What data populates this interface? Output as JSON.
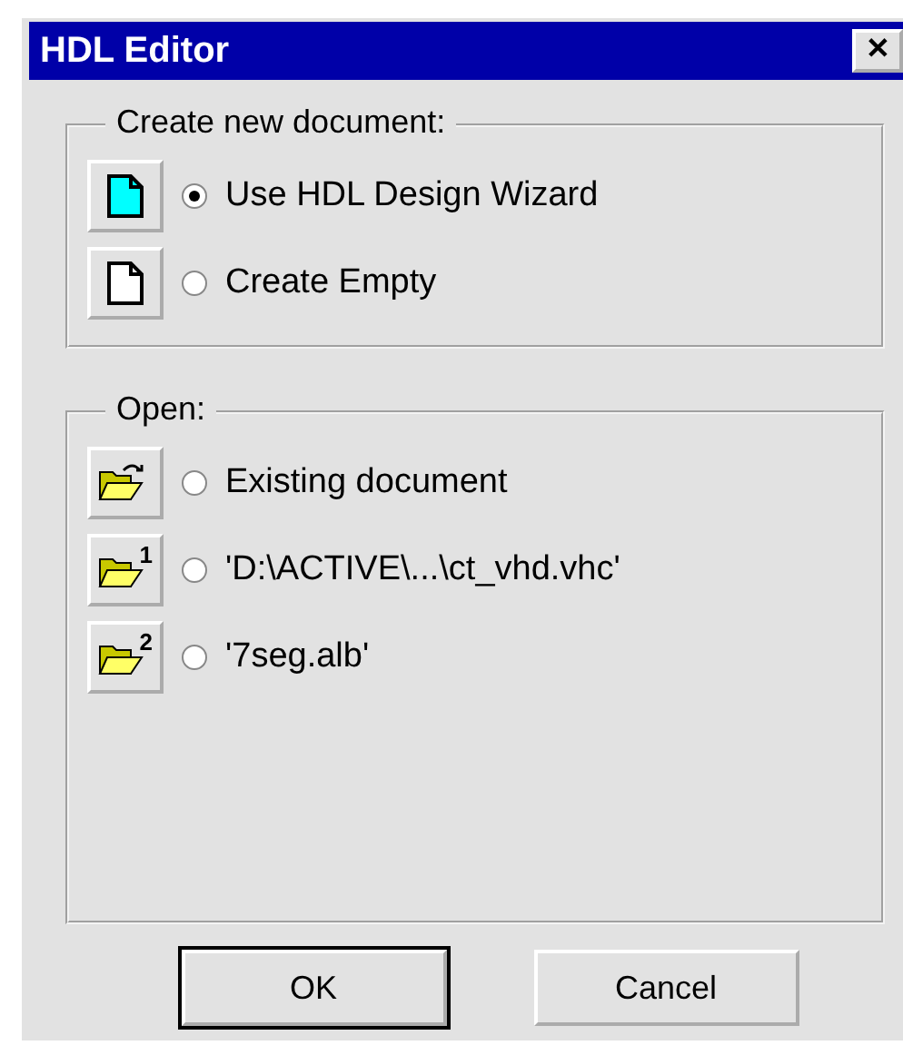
{
  "window": {
    "title": "HDL Editor",
    "close": "✕"
  },
  "groups": [
    {
      "title": "Create new document:",
      "options": [
        {
          "kind": "wizard",
          "label": "Use HDL Design Wizard",
          "selected": true
        },
        {
          "kind": "blank",
          "label": "Create Empty",
          "selected": false
        }
      ]
    },
    {
      "title": "Open:",
      "options": [
        {
          "kind": "open",
          "label": "Existing document",
          "selected": false
        },
        {
          "kind": "recent",
          "badge": "1",
          "label": "'D:\\ACTIVE\\...\\ct_vhd.vhc'",
          "selected": false
        },
        {
          "kind": "recent",
          "badge": "2",
          "label": "'7seg.alb'",
          "selected": false
        }
      ]
    }
  ],
  "buttons": [
    {
      "label": "OK",
      "default": true
    },
    {
      "label": "Cancel",
      "default": false
    }
  ]
}
